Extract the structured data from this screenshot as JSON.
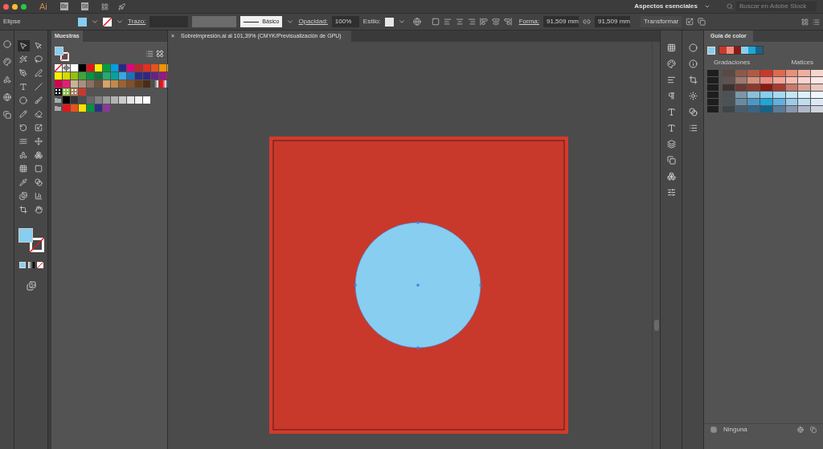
{
  "app_bar": {
    "logo": "Ai",
    "apps": [
      "Br",
      "St"
    ],
    "workspace": "Aspectos esenciales",
    "search": {
      "placeholder": "Buscar en Adobe Stock"
    }
  },
  "control_bar": {
    "object": "Elipse",
    "stroke_label": "Trazo:",
    "brush": "Básico",
    "opacity_label": "Opacidad:",
    "opacity": "100%",
    "style_label": "Estilo:",
    "shape_label": "Forma:",
    "width": "91,509 mm",
    "height": "91,509 mm",
    "transform": "Transformar"
  },
  "tools": [
    {
      "selected": true
    },
    {
      "selected": false
    },
    {
      "selected": false
    },
    {
      "selected": false
    },
    {
      "selected": false
    },
    {
      "selected": false
    },
    {
      "selected": false
    },
    {
      "selected": false
    },
    {
      "selected": false
    },
    {
      "selected": false
    },
    {
      "selected": false
    },
    {
      "selected": false
    },
    {
      "selected": false
    },
    {
      "selected": false
    },
    {
      "selected": false
    },
    {
      "selected": false
    },
    {
      "selected": false
    },
    {
      "selected": false
    },
    {
      "selected": false
    },
    {
      "selected": false
    },
    {
      "selected": false
    },
    {
      "selected": false
    },
    {
      "selected": false
    },
    {
      "selected": false
    },
    {
      "selected": false
    },
    {
      "selected": false
    }
  ],
  "swatches_panel": {
    "title": "Muestras",
    "rows": [
      {
        "group": false,
        "swatches": [
          {
            "kind": "none"
          },
          {
            "kind": "registration"
          },
          {
            "kind": "solid",
            "color": "#ffffff"
          },
          {
            "kind": "solid",
            "color": "#000000"
          },
          {
            "kind": "solid",
            "color": "#e3151b"
          },
          {
            "kind": "solid",
            "color": "#ffec00"
          },
          {
            "kind": "solid",
            "color": "#00a13a"
          },
          {
            "kind": "solid",
            "color": "#009fe3"
          },
          {
            "kind": "solid",
            "color": "#2b2a84"
          },
          {
            "kind": "solid",
            "color": "#e5007d"
          },
          {
            "kind": "solid",
            "color": "#c0252b"
          },
          {
            "kind": "solid",
            "color": "#e52f24"
          },
          {
            "kind": "solid",
            "color": "#e9521d"
          },
          {
            "kind": "solid",
            "color": "#f39200"
          },
          {
            "kind": "solid",
            "color": "#f6a533"
          }
        ]
      },
      {
        "group": false,
        "swatches": [
          {
            "kind": "solid",
            "color": "#ffed00"
          },
          {
            "kind": "solid",
            "color": "#d5d900"
          },
          {
            "kind": "solid",
            "color": "#97bf0d"
          },
          {
            "kind": "solid",
            "color": "#3fa535"
          },
          {
            "kind": "solid",
            "color": "#009640"
          },
          {
            "kind": "solid",
            "color": "#16743a"
          },
          {
            "kind": "solid",
            "color": "#29a870"
          },
          {
            "kind": "solid",
            "color": "#00a49a"
          },
          {
            "kind": "solid",
            "color": "#36a9e1"
          },
          {
            "kind": "solid",
            "color": "#1d71b8"
          },
          {
            "kind": "solid",
            "color": "#2d2e83"
          },
          {
            "kind": "solid",
            "color": "#312782"
          },
          {
            "kind": "solid",
            "color": "#662483"
          },
          {
            "kind": "solid",
            "color": "#951b81"
          },
          {
            "kind": "solid",
            "color": "#a3195b"
          }
        ]
      },
      {
        "group": false,
        "swatches": [
          {
            "kind": "solid",
            "color": "#d6004e"
          },
          {
            "kind": "solid",
            "color": "#e71d73"
          },
          {
            "kind": "solid",
            "color": "#c9b393"
          },
          {
            "kind": "solid",
            "color": "#a8907c"
          },
          {
            "kind": "solid",
            "color": "#8a7060"
          },
          {
            "kind": "solid",
            "color": "#6b5444"
          },
          {
            "kind": "solid",
            "color": "#d6a368"
          },
          {
            "kind": "solid",
            "color": "#c18a4a"
          },
          {
            "kind": "solid",
            "color": "#a06030"
          },
          {
            "kind": "solid",
            "color": "#82502a"
          },
          {
            "kind": "solid",
            "color": "#683c18"
          },
          {
            "kind": "solid",
            "color": "#4a2c18"
          },
          {
            "kind": "gradient",
            "color": "#4d4d4d"
          },
          {
            "kind": "gradient",
            "color": "#e3151b"
          },
          {
            "kind": "gradient",
            "color": "#1d71b8"
          }
        ]
      },
      {
        "group": false,
        "swatches": [
          {
            "kind": "pattern",
            "color": "#111111"
          },
          {
            "kind": "pattern",
            "color": "#8fbc4a"
          },
          {
            "kind": "pattern",
            "color": "#b08060"
          },
          {
            "kind": "solid",
            "color": "#c8392b"
          }
        ]
      },
      {
        "group": true,
        "swatches": [
          {
            "kind": "solid",
            "color": "#000000"
          },
          {
            "kind": "solid",
            "color": "#333333"
          },
          {
            "kind": "solid",
            "color": "#4d4d4d"
          },
          {
            "kind": "solid",
            "color": "#666666"
          },
          {
            "kind": "solid",
            "color": "#808080"
          },
          {
            "kind": "solid",
            "color": "#999999"
          },
          {
            "kind": "solid",
            "color": "#b3b3b3"
          },
          {
            "kind": "solid",
            "color": "#cccccc"
          },
          {
            "kind": "solid",
            "color": "#e6e6e6"
          },
          {
            "kind": "solid",
            "color": "#f2f2f2"
          },
          {
            "kind": "solid",
            "color": "#ffffff"
          }
        ]
      },
      {
        "group": true,
        "swatches": [
          {
            "kind": "solid",
            "color": "#e3151b"
          },
          {
            "kind": "solid",
            "color": "#e9521d"
          },
          {
            "kind": "solid",
            "color": "#ffde00"
          },
          {
            "kind": "solid",
            "color": "#009640"
          },
          {
            "kind": "solid",
            "color": "#2d2e83"
          },
          {
            "kind": "solid",
            "color": "#8a3a96"
          }
        ]
      }
    ]
  },
  "document_tab": {
    "close": "×",
    "title": "Sobreimpresión.ai al 101,39% (CMYK/Previsualización de GPU)"
  },
  "color_guide": {
    "title": "Guía de color",
    "harmony": [
      {
        "color": "#c8392b"
      },
      {
        "color": "#f08a80"
      },
      {
        "color": "#8b1a14"
      },
      {
        "color": "#87cef0"
      },
      {
        "color": "#1ea6d8"
      },
      {
        "color": "#17648a"
      }
    ],
    "left_header": "Gradaciones",
    "right_header": "Matices",
    "rows": [
      {
        "cells": [
          {
            "color": "#1e1e1e"
          },
          {
            "color": "#5a4844"
          },
          {
            "color": "#8c5a4a"
          },
          {
            "color": "#b05a44"
          },
          {
            "color": "#c8392b"
          },
          {
            "color": "#dd6a50"
          },
          {
            "color": "#e8907a"
          },
          {
            "color": "#eeb09e"
          },
          {
            "color": "#f6d6cc"
          }
        ]
      },
      {
        "cells": [
          {
            "color": "#1e1e1e"
          },
          {
            "color": "#5e5350"
          },
          {
            "color": "#9e7a70"
          },
          {
            "color": "#d89080"
          },
          {
            "color": "#f08a80"
          },
          {
            "color": "#f5a49a"
          },
          {
            "color": "#f8bcb4"
          },
          {
            "color": "#fad4ce"
          },
          {
            "color": "#fde8e4"
          }
        ]
      },
      {
        "cells": [
          {
            "color": "#1e1e1e"
          },
          {
            "color": "#3e3230"
          },
          {
            "color": "#6a3a32"
          },
          {
            "color": "#8c3a2c"
          },
          {
            "color": "#8b1a14"
          },
          {
            "color": "#a83a2e"
          },
          {
            "color": "#c8786a"
          },
          {
            "color": "#d8a094"
          },
          {
            "color": "#e8c8c0"
          }
        ]
      },
      {
        "cells": [
          {
            "color": "#1e1e1e"
          },
          {
            "color": "#4a5258"
          },
          {
            "color": "#7a98a8"
          },
          {
            "color": "#8ac0da"
          },
          {
            "color": "#87cef0"
          },
          {
            "color": "#a6daf4"
          },
          {
            "color": "#c2e6f8"
          },
          {
            "color": "#daf0fc"
          },
          {
            "color": "#eef8fe"
          }
        ]
      },
      {
        "cells": [
          {
            "color": "#1e1e1e"
          },
          {
            "color": "#4a5258"
          },
          {
            "color": "#6a8aa0"
          },
          {
            "color": "#4a98c8"
          },
          {
            "color": "#1ea6d8"
          },
          {
            "color": "#60b0e0"
          },
          {
            "color": "#9ccce8"
          },
          {
            "color": "#c0dcf0"
          },
          {
            "color": "#dce8f4"
          }
        ]
      },
      {
        "cells": [
          {
            "color": "#1e1e1e"
          },
          {
            "color": "#3e4448"
          },
          {
            "color": "#4a5c6c"
          },
          {
            "color": "#3a6484"
          },
          {
            "color": "#17648a"
          },
          {
            "color": "#5a7c98"
          },
          {
            "color": "#8898b0"
          },
          {
            "color": "#b0b8c8"
          },
          {
            "color": "#d0d4de"
          }
        ]
      }
    ],
    "footer": "Ninguna"
  }
}
